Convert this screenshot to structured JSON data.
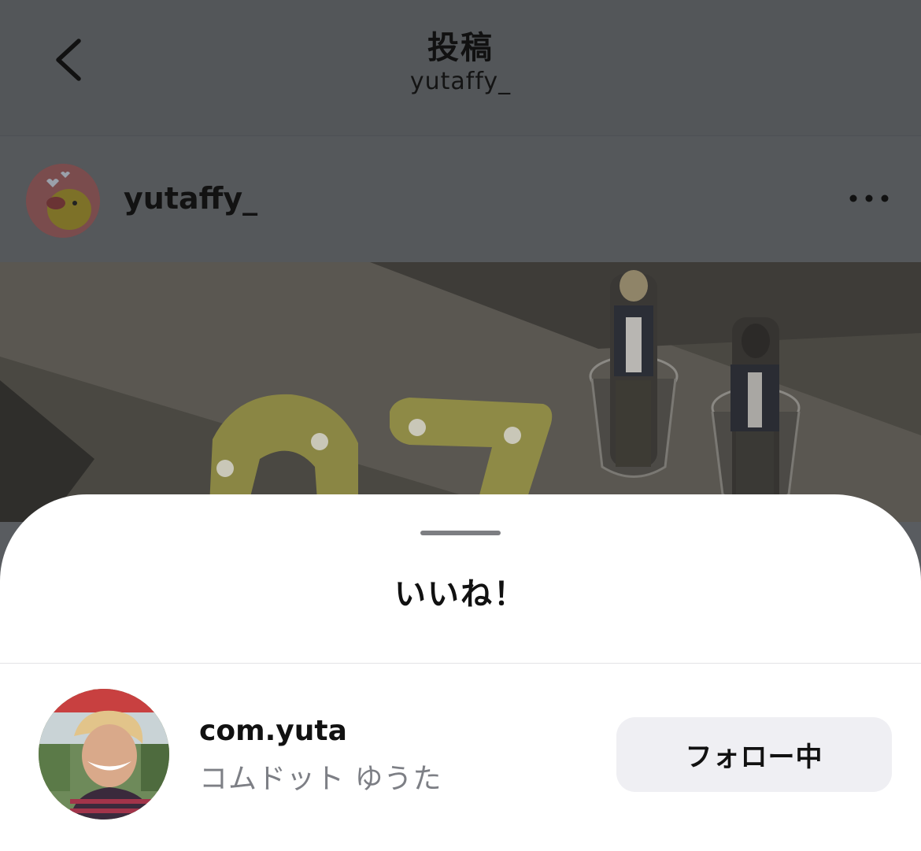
{
  "nav": {
    "title": "投稿",
    "subtitle": "yutaffy_"
  },
  "post": {
    "username": "yutaffy_"
  },
  "likes_sheet": {
    "title": "いいね！",
    "users": [
      {
        "handle": "com.yuta",
        "display_name": "コムドット ゆうた",
        "follow_label": "フォロー中"
      }
    ]
  },
  "colors": {
    "dim_overlay": "#595c60",
    "sheet_bg": "#ffffff",
    "follow_button_bg": "#efeff3",
    "secondary_text": "#7d7f85"
  },
  "icons": {
    "back": "chevron-left-icon",
    "more": "more-horizontal-icon"
  }
}
